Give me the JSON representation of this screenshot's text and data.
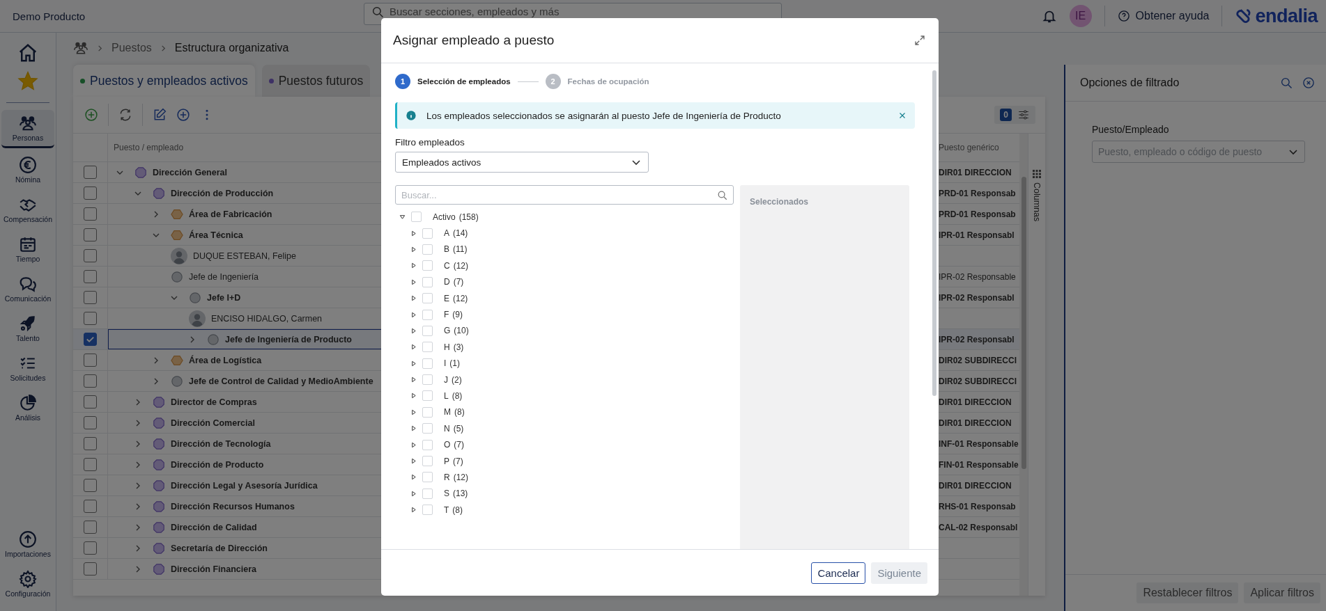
{
  "header": {
    "app_name": "Demo Producto",
    "search": {
      "placeholder": "Buscar secciones, empleados y más"
    },
    "avatar": "IE",
    "help": "Obtener ayuda",
    "logo": "endalia"
  },
  "sidebar": {
    "nav": [
      {
        "kind": "people",
        "label": "Personas",
        "selected": true
      },
      {
        "kind": "euro",
        "label": "Nómina",
        "selected": false
      },
      {
        "kind": "handshake",
        "label": "Compensación",
        "selected": false
      },
      {
        "kind": "calendar",
        "label": "Tiempo",
        "selected": false
      },
      {
        "kind": "chat",
        "label": "Comunicación",
        "selected": false
      },
      {
        "kind": "rocket",
        "label": "Talento",
        "selected": false
      },
      {
        "kind": "checklist",
        "label": "Solicitudes",
        "selected": false
      },
      {
        "kind": "pie",
        "label": "Análisis",
        "selected": false
      }
    ],
    "bottom": [
      {
        "kind": "upload",
        "label": "Importaciones",
        "selected": false
      },
      {
        "kind": "gear",
        "label": "Configuración",
        "selected": false
      }
    ]
  },
  "breadcrumb": [
    "Puestos",
    "Estructura organizativa"
  ],
  "tabs": [
    {
      "label": "Puestos y empleados activos",
      "selected": true,
      "color": "#174f28"
    },
    {
      "label": "Puestos futuros",
      "selected": false,
      "color": "#3e3165"
    }
  ],
  "table": {
    "filter_count": "0",
    "columns_tab": "Columnas",
    "columns": [
      "Puesto / empleado",
      "Puesto genérico"
    ],
    "rows": [
      {
        "kind": "direction",
        "name": "Dirección General",
        "generic": "DIR01 DIRECCION",
        "bold": true,
        "checked": false,
        "expanded": true,
        "children": [
          {
            "kind": "direction",
            "name": "Dirección de Producción",
            "generic": "PRD-01 Responsab",
            "bold": true,
            "checked": false,
            "expanded": true,
            "children": [
              {
                "kind": "area",
                "name": "Área de Fabricación",
                "generic": "PRD-01 Responsab",
                "bold": true,
                "checked": false,
                "expanded": false
              },
              {
                "kind": "area",
                "name": "Área Técnica",
                "generic": "IPR-01 Responsabl",
                "bold": true,
                "checked": false,
                "expanded": true,
                "children": [
                  {
                    "kind": "person",
                    "name": "DUQUE ESTEBAN, Felipe",
                    "bold": false,
                    "checked": false
                  },
                  {
                    "kind": "post",
                    "name": "Jefe de Ingeniería",
                    "generic": "IPR-02 Responsable",
                    "bold": false,
                    "checked": false
                  },
                  {
                    "kind": "post",
                    "name": "Jefe I+D",
                    "generic": "IPR-02 Responsabl",
                    "bold": true,
                    "checked": false,
                    "expanded": true,
                    "children": [
                      {
                        "kind": "person",
                        "name": "ENCISO HIDALGO, Carmen",
                        "bold": false,
                        "checked": false
                      },
                      {
                        "kind": "post",
                        "name": "Jefe de Ingeniería de Producto",
                        "generic": "IPR-02 Responsabl",
                        "bold": true,
                        "checked": true,
                        "expanded": false
                      }
                    ]
                  }
                ]
              },
              {
                "kind": "area",
                "name": "Área de Logística",
                "generic": "DIR02 SUBDIRECCI",
                "bold": true,
                "checked": false,
                "expanded": false
              },
              {
                "kind": "post",
                "name": "Jefe de Control de Calidad y MedioAmbiente",
                "generic": "DIR02 SUBDIRECCI",
                "bold": true,
                "checked": false,
                "expanded": false
              }
            ]
          },
          {
            "kind": "direction",
            "name": "Director de Compras",
            "generic": "DIR01 DIRECCION",
            "bold": true,
            "checked": false,
            "expanded": false
          },
          {
            "kind": "direction",
            "name": "Dirección Comercial",
            "generic": "DIR01 DIRECCION",
            "bold": true,
            "checked": false,
            "expanded": false
          },
          {
            "kind": "direction",
            "name": "Dirección de Tecnología",
            "generic": "INF-01 Responsable",
            "bold": true,
            "checked": false,
            "expanded": false
          },
          {
            "kind": "direction",
            "name": "Dirección de Producto",
            "generic": "FIN-01 Responsable",
            "bold": true,
            "checked": false,
            "expanded": false
          },
          {
            "kind": "direction",
            "name": "Dirección Legal y Asesoría Jurídica",
            "generic": "DIR01 DIRECCION",
            "bold": true,
            "checked": false,
            "expanded": false
          },
          {
            "kind": "direction",
            "name": "Dirección Recursos Humanos",
            "generic": "RHS-01 Responsab",
            "bold": true,
            "checked": false,
            "expanded": false
          },
          {
            "kind": "direction",
            "name": "Dirección de Calidad",
            "generic": "CAL-02 Responsabl",
            "bold": true,
            "checked": false,
            "expanded": false
          },
          {
            "kind": "direction",
            "name": "Secretaría de Dirección",
            "bold": true,
            "checked": false,
            "expanded": false
          },
          {
            "kind": "direction",
            "name": "Dirección Financiera",
            "bold": true,
            "checked": false,
            "expanded": false
          }
        ]
      }
    ]
  },
  "filter_panel": {
    "title": "Opciones de filtrado",
    "field_label": "Puesto/Empleado",
    "placeholder": "Puesto, empleado o código de puesto",
    "buttons": [
      "Restablecer filtros",
      "Aplicar filtros"
    ]
  },
  "modal": {
    "title": "Asignar empleado a puesto",
    "steps": [
      {
        "number": "1",
        "label": "Selección de empleados",
        "selected": true
      },
      {
        "number": "2",
        "label": "Fechas de ocupación",
        "selected": false
      }
    ],
    "alert": "Los empleados seleccionados se asignarán al puesto Jefe de Ingeniería de Producto",
    "filter_label": "Filtro empleados",
    "filter_value": "Empleados activos",
    "search": {
      "placeholder": "Buscar..."
    },
    "tree": [
      {
        "label": "Activo",
        "count": "(158)",
        "expanded": true,
        "checked": false,
        "children": [
          {
            "label": "A",
            "count": "(14)",
            "expanded": false,
            "checked": false
          },
          {
            "label": "B",
            "count": "(11)",
            "expanded": false,
            "checked": false
          },
          {
            "label": "C",
            "count": "(12)",
            "expanded": false,
            "checked": false
          },
          {
            "label": "D",
            "count": "(7)",
            "expanded": false,
            "checked": false
          },
          {
            "label": "E",
            "count": "(12)",
            "expanded": false,
            "checked": false
          },
          {
            "label": "F",
            "count": "(9)",
            "expanded": false,
            "checked": false
          },
          {
            "label": "G",
            "count": "(10)",
            "expanded": false,
            "checked": false
          },
          {
            "label": "H",
            "count": "(3)",
            "expanded": false,
            "checked": false
          },
          {
            "label": "I",
            "count": "(1)",
            "expanded": false,
            "checked": false
          },
          {
            "label": "J",
            "count": "(2)",
            "expanded": false,
            "checked": false
          },
          {
            "label": "L",
            "count": "(8)",
            "expanded": false,
            "checked": false
          },
          {
            "label": "M",
            "count": "(8)",
            "expanded": false,
            "checked": false
          },
          {
            "label": "N",
            "count": "(5)",
            "expanded": false,
            "checked": false
          },
          {
            "label": "O",
            "count": "(7)",
            "expanded": false,
            "checked": false
          },
          {
            "label": "P",
            "count": "(7)",
            "expanded": false,
            "checked": false
          },
          {
            "label": "R",
            "count": "(12)",
            "expanded": false,
            "checked": false
          },
          {
            "label": "S",
            "count": "(13)",
            "expanded": false,
            "checked": false
          },
          {
            "label": "T",
            "count": "(8)",
            "expanded": false,
            "checked": false
          }
        ]
      }
    ],
    "selected_title": "Seleccionados",
    "buttons": [
      {
        "label": "Cancelar",
        "kind": "outline",
        "disabled": false
      },
      {
        "label": "Siguiente",
        "kind": "primary",
        "disabled": true
      }
    ]
  }
}
